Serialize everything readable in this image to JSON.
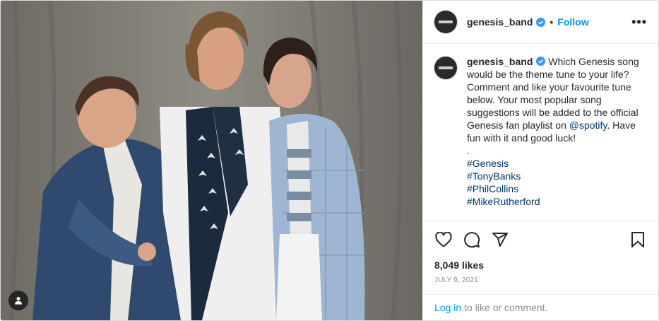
{
  "post": {
    "username": "genesis_band",
    "follow_label": "Follow",
    "separator": "•",
    "more_label": "•••"
  },
  "caption": {
    "username": "genesis_band",
    "text_before_mention": "Which Genesis song would be the theme tune to your life? Comment and like your favourite tune below. Your most popular song suggestions will be added to the official Genesis fan playlist on ",
    "mention": "@spotify",
    "text_after_mention": ". Have fun with it and good luck!",
    "dot_line": ".",
    "hashtags": [
      "#Genesis",
      "#TonyBanks",
      "#PhilCollins",
      "#MikeRutherford"
    ]
  },
  "stats": {
    "likes": "8,049 likes",
    "date": "JULY 9, 2021"
  },
  "footer": {
    "login_link": "Log in",
    "login_text": "to like or comment."
  },
  "icons": {
    "like": "heart-icon",
    "comment": "comment-icon",
    "share": "share-icon",
    "save": "bookmark-icon",
    "tag": "user-tag-icon",
    "verified": "verified-badge-icon"
  },
  "colors": {
    "link_blue": "#0095f6",
    "hashtag_blue": "#00376b",
    "muted": "#8e8e8e",
    "text": "#262626"
  }
}
